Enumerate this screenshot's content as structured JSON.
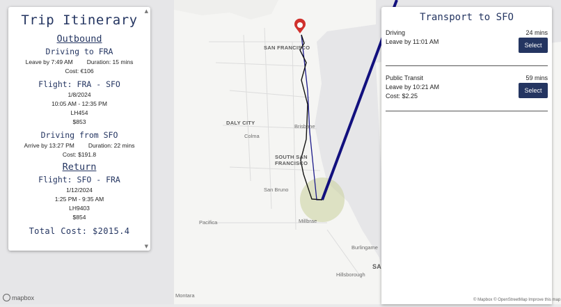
{
  "itinerary": {
    "title": "Trip Itinerary",
    "outbound": {
      "heading": "Outbound",
      "drive_to": {
        "title": "Driving to FRA",
        "leave": "Leave by 7:49 AM",
        "duration": "Duration: 15 mins",
        "cost": "Cost: €106"
      },
      "flight": {
        "title": "Flight: FRA - SFO",
        "date": "1/8/2024",
        "times": "10:05 AM - 12:35 PM",
        "number": "LH454",
        "price": "$853"
      },
      "drive_from": {
        "title": "Driving from SFO",
        "arrive": "Arrive by 13:27 PM",
        "duration": "Duration: 22 mins",
        "cost": "Cost: $191.8"
      }
    },
    "return": {
      "heading": "Return",
      "flight": {
        "title": "Flight: SFO - FRA",
        "date": "1/12/2024",
        "times": "1:25 PM - 9:35 AM",
        "number": "LH9403",
        "price": "$854"
      }
    },
    "total": "Total Cost: $2015.4"
  },
  "transport": {
    "title": "Transport to SFO",
    "options": [
      {
        "name": "Driving",
        "duration": "24 mins",
        "line1": "Leave by 11:01 AM",
        "line2": "",
        "button": "Select"
      },
      {
        "name": "Public Transit",
        "duration": "59 mins",
        "line1": "Leave by 10:21 AM",
        "line2": "Cost: $2.25",
        "button": "Select"
      }
    ]
  },
  "map": {
    "labels": {
      "sf": "SAN FRANCISCO",
      "daly": "DALY CITY",
      "colma": "Colma",
      "brisbane": "Brisbane",
      "ssf1": "SOUTH SAN",
      "ssf2": "FRANCISCO",
      "sanbruno": "San Bruno",
      "pacifica": "Pacifica",
      "millbrae": "Millbrae",
      "burlingame": "Burlingame",
      "hillsborough": "Hillsborough",
      "montara": "Montara",
      "sa": "SA"
    },
    "logo": "mapbox",
    "attribution": "© Mapbox © OpenStreetMap Improve this map",
    "colors": {
      "route_driving": "#111111",
      "route_transit": "#1c1a8a",
      "flight_path": "#12107e",
      "pin": "#d0312d"
    }
  }
}
